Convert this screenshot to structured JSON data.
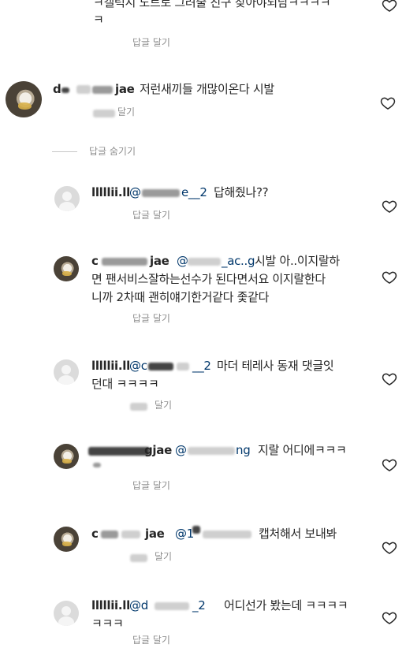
{
  "colors": {
    "text": "#262626",
    "muted": "#8e8e8e",
    "background": "#ffffff"
  },
  "top_comment": {
    "text": "ㅋ갤럭시 노트로 그려줄 친구 찾아야되남ㅋㅋㅋㅋ",
    "text2": "ㅋ",
    "reply": "답글 달기",
    "icon": "heart-icon"
  },
  "main_comment": {
    "username_start": "d",
    "username_end": "jae",
    "text": "저런새끼들 개많이온다 시발",
    "action": "달기",
    "icon": "heart-icon"
  },
  "hide_replies": "답글 숨기기",
  "replies": [
    {
      "username": "lllllii.ll",
      "mention_start": "@",
      "mention_end": "e__2",
      "text_line1": "답해줬나??",
      "reply": "답글 달기"
    },
    {
      "username_start": "c",
      "username_end": "jae",
      "mention_start": "@",
      "mention_end": "_ac..g",
      "text_line1": "시발 아..이지랄하",
      "text_line2": "면 팬서비스잘하는선수가 된다면서요 이지랄한다",
      "text_line3": "니까 2차때 괜히얘기한거같다 좇같다",
      "reply": "답글 달기"
    },
    {
      "username": "lllllii.ll",
      "mention_start": "@c",
      "mention_end": "__2",
      "text_line1": "마더 테레사 동재 댓글잇",
      "text_line2": "던대 ㅋㅋㅋㅋ",
      "reply": "달기"
    },
    {
      "username_end": "gjae",
      "mention_start": "@",
      "mention_end": "ng",
      "text_line1": "지랄 어디에ㅋㅋㅋ",
      "reply": "답글 달기"
    },
    {
      "username_start": "c",
      "username_end": "jae",
      "mention_start": "@1",
      "text_line1": "캡처해서 보내봐",
      "reply": "달기"
    },
    {
      "username": "lllllii.ll",
      "mention_start": "@d",
      "mention_end": "_2",
      "text_line1": "어디선가 봤는데 ㅋㅋㅋㅋ",
      "text_line2": "ㅋㅋㅋ",
      "reply": "답글 달기"
    }
  ]
}
